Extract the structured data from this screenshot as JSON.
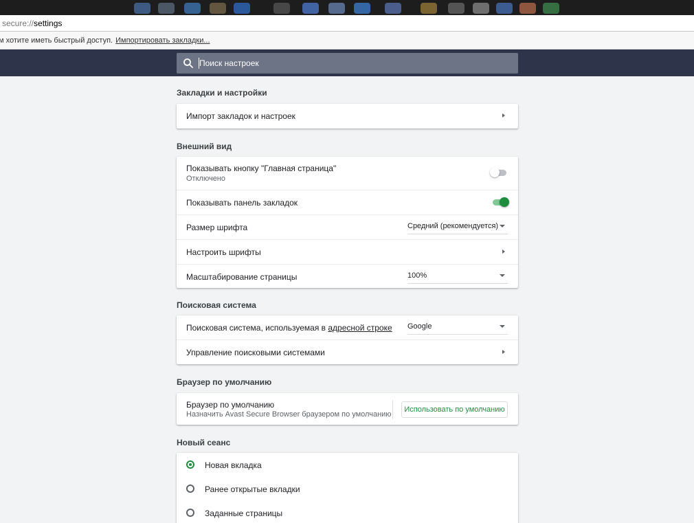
{
  "browser": {
    "url_scheme": "secure://",
    "url_path": "settings",
    "bookmarks_bar_text": "м хотите иметь быстрый доступ.",
    "bookmarks_bar_link": "Импортировать закладки..."
  },
  "search": {
    "placeholder": "Поиск настроек"
  },
  "sections": {
    "bookmarks": {
      "title": "Закладки и настройки",
      "import_label": "Импорт закладок и настроек"
    },
    "appearance": {
      "title": "Внешний вид",
      "home_button_label": "Показывать кнопку \"Главная страница\"",
      "home_button_status": "Отключено",
      "home_button_enabled": false,
      "bookmarks_bar_label": "Показывать панель закладок",
      "bookmarks_bar_enabled": true,
      "font_size_label": "Размер шрифта",
      "font_size_value": "Средний (рекомендуется)",
      "customize_fonts_label": "Настроить шрифты",
      "zoom_label": "Масштабирование страницы",
      "zoom_value": "100%"
    },
    "search_engine": {
      "title": "Поисковая система",
      "engine_label_prefix": "Поисковая система, используемая в ",
      "engine_label_link": "адресной строке",
      "engine_value": "Google",
      "manage_label": "Управление поисковыми системами"
    },
    "default_browser": {
      "title": "Браузер по умолчанию",
      "label": "Браузер по умолчанию",
      "sublabel": "Назначить Avast Secure Browser браузером по умолчанию",
      "button_label": "Использовать по умолчанию"
    },
    "startup": {
      "title": "Новый сеанс",
      "options": [
        {
          "label": "Новая вкладка",
          "checked": true
        },
        {
          "label": "Ранее открытые вкладки",
          "checked": false
        },
        {
          "label": "Заданные страницы",
          "checked": false
        }
      ]
    }
  },
  "colors": {
    "header_bg": "#2e354b",
    "accent_green": "#1e8e3e",
    "page_bg": "#f1f3f4"
  }
}
